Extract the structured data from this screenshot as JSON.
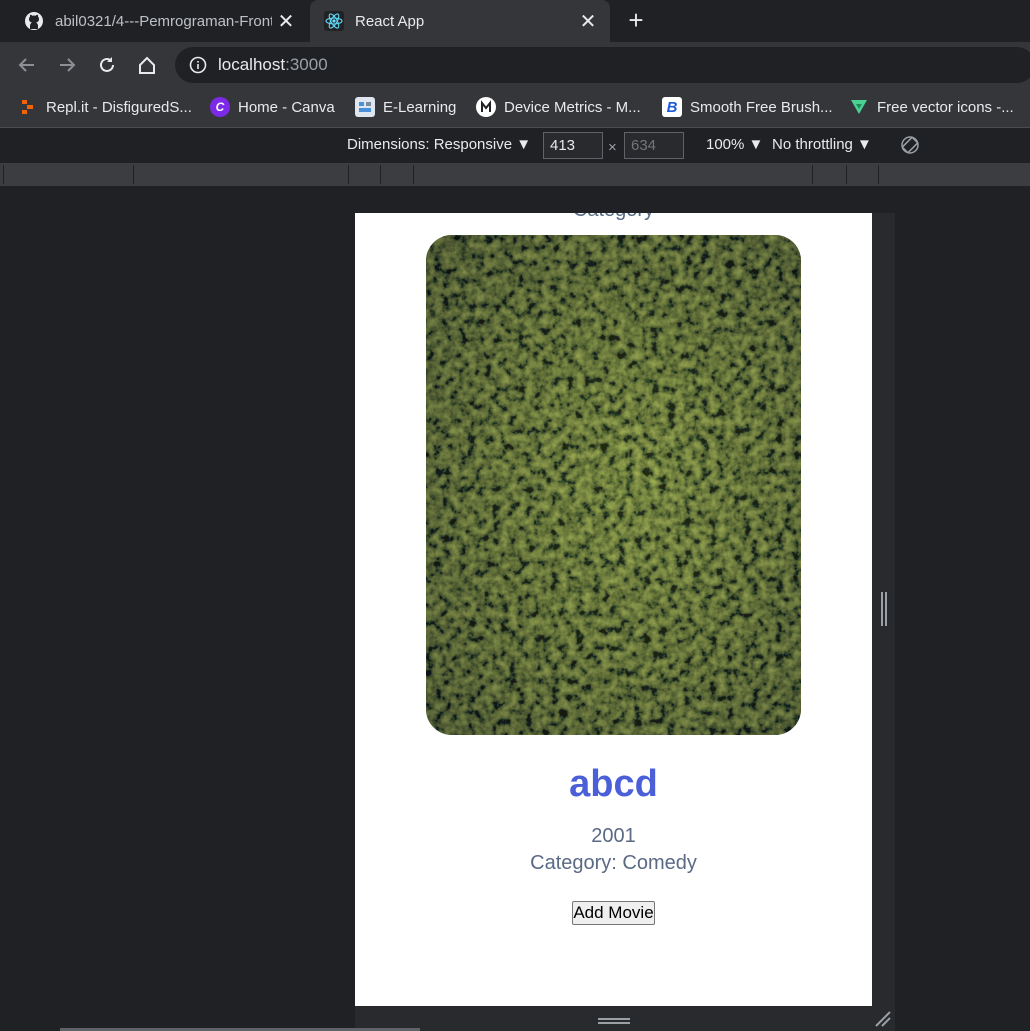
{
  "tabs": [
    {
      "title": "abil0321/4---Pemrograman-Front",
      "icon": "github-icon",
      "active": false
    },
    {
      "title": "React App",
      "icon": "react-icon",
      "active": true
    }
  ],
  "toolbar": {
    "url_host": "localhost",
    "url_port": ":3000"
  },
  "bookmarks": [
    {
      "label": "Repl.it - DisfiguredS...",
      "icon": "replit-icon",
      "color": "#f26207"
    },
    {
      "label": "Home - Canva",
      "icon": "canva-icon",
      "color": "#7d2ae8"
    },
    {
      "label": "E-Learning",
      "icon": "elearning-icon",
      "color": "#4a90d9"
    },
    {
      "label": "Device Metrics - M...",
      "icon": "material-icon",
      "color": "#ffffff"
    },
    {
      "label": "Smooth Free Brush...",
      "icon": "b-icon",
      "color": "#1e5bd8"
    },
    {
      "label": "Free vector icons -...",
      "icon": "flaticon-icon",
      "color": "#4ad295"
    }
  ],
  "devtools": {
    "dimensions_label": "Dimensions: Responsive ▼",
    "width_value": "413",
    "height_placeholder": "634",
    "times": "×",
    "zoom": "100% ▼",
    "throttling": "No throttling ▼"
  },
  "page": {
    "cut_text": "Category",
    "movie_title": "abcd",
    "movie_year": "2001",
    "movie_category": "Category: Comedy",
    "add_button": "Add Movie"
  },
  "colors": {
    "title_color": "#4b5fd8",
    "meta_color": "#5a6a85"
  }
}
